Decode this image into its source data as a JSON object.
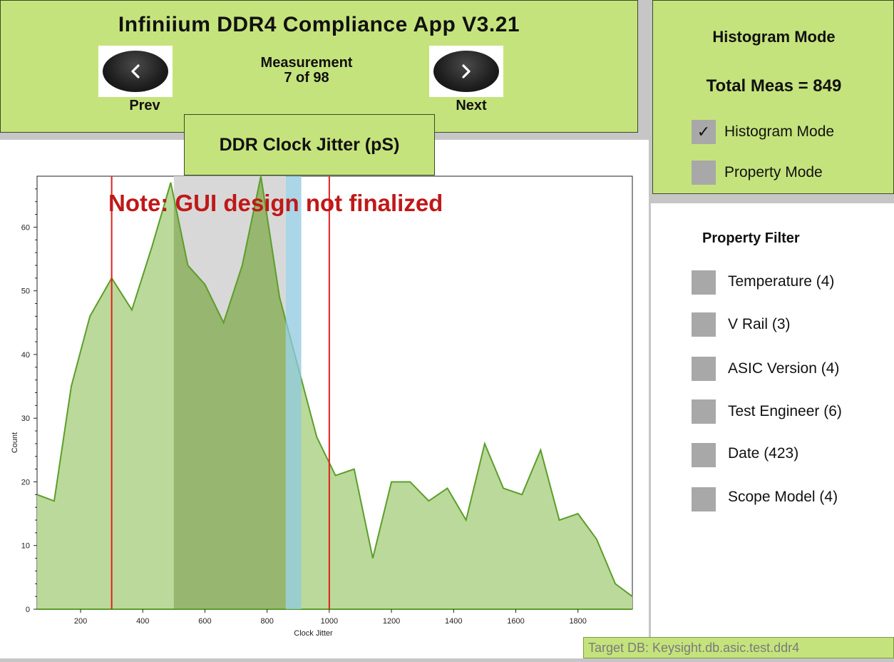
{
  "header": {
    "title": "Infiniium DDR4 Compliance App V3.21",
    "measurement_label": "Measurement",
    "measurement_position": "7 of 98",
    "prev_label": "Prev",
    "next_label": "Next"
  },
  "chart_title": "DDR Clock Jitter (pS)",
  "note": "Note: GUI design not finalized",
  "mode_panel": {
    "heading": "Histogram Mode",
    "total": "Total Meas = 849",
    "options": [
      {
        "label": "Histogram Mode",
        "checked": true,
        "mark": "✓"
      },
      {
        "label": "Property Mode",
        "checked": false,
        "mark": ""
      }
    ]
  },
  "filter_panel": {
    "heading": "Property Filter",
    "items": [
      {
        "label": "Temperature (4)"
      },
      {
        "label": "V Rail (3)"
      },
      {
        "label": "ASIC Version (4)"
      },
      {
        "label": "Test Engineer (6)"
      },
      {
        "label": "Date (423)"
      },
      {
        "label": "Scope Model (4)"
      }
    ]
  },
  "status": {
    "target_db": "Target DB: Keysight.db.asic.test.ddr4"
  },
  "colors": {
    "panel_green": "#c5e37c",
    "area_fill": "#b7d795",
    "area_line": "#5b9e2a",
    "marker_red": "#e02020",
    "note_red": "#c01818",
    "selection_gray": "#d8d8d8",
    "band_blue": "#8fc8df"
  },
  "chart_data": {
    "type": "area",
    "xlabel": "Clock Jitter",
    "ylabel": "Count",
    "xlim": [
      60,
      1975
    ],
    "ylim": [
      0,
      68
    ],
    "x_ticks": [
      200,
      400,
      600,
      800,
      1000,
      1200,
      1400,
      1600,
      1800
    ],
    "y_ticks": [
      0,
      10,
      20,
      30,
      40,
      50,
      60
    ],
    "x": [
      60,
      115,
      170,
      230,
      300,
      365,
      430,
      490,
      545,
      600,
      660,
      720,
      780,
      840,
      900,
      960,
      1020,
      1080,
      1140,
      1200,
      1260,
      1320,
      1380,
      1440,
      1500,
      1560,
      1620,
      1680,
      1740,
      1800,
      1860,
      1920,
      1975
    ],
    "y": [
      18,
      17,
      35,
      46,
      52,
      47,
      57,
      67,
      54,
      51,
      45,
      54,
      68,
      49,
      38,
      27,
      21,
      22,
      8,
      20,
      20,
      17,
      19,
      14,
      26,
      19,
      18,
      25,
      14,
      15,
      11,
      4,
      2
    ],
    "marker_lines_x": [
      300,
      1000
    ],
    "selection_range": [
      500,
      860
    ],
    "highlight_band": [
      860,
      910
    ]
  }
}
